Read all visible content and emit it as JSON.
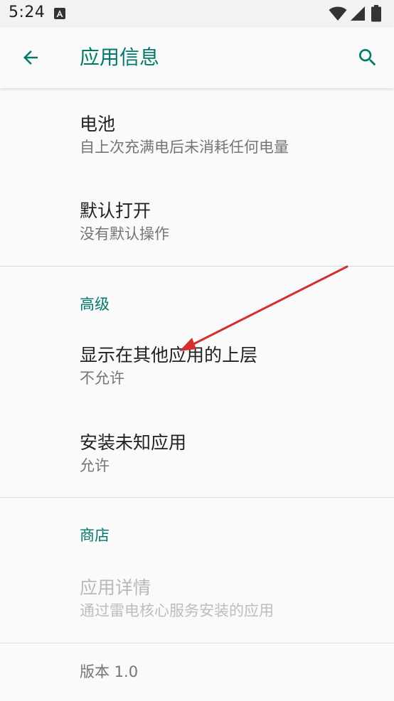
{
  "status_bar": {
    "time": "5:24",
    "notification_icon": "a-icon",
    "wifi_icon": "wifi-icon",
    "signal_icon": "signal-icon",
    "battery_icon": "battery-icon"
  },
  "app_bar": {
    "title": "应用信息",
    "back_icon": "arrow-back-icon",
    "search_icon": "search-icon",
    "accent_color": "#00796b"
  },
  "preferences": {
    "battery": {
      "title": "电池",
      "summary": "自上次充满电后未消耗任何电量"
    },
    "open_by_default": {
      "title": "默认打开",
      "summary": "没有默认操作"
    },
    "advanced": {
      "header": "高级",
      "draw_over": {
        "title": "显示在其他应用的上层",
        "summary": "不允许"
      },
      "install_unknown": {
        "title": "安装未知应用",
        "summary": "允许"
      }
    },
    "store": {
      "header": "商店",
      "app_details": {
        "title": "应用详情",
        "summary": "通过雷电核心服务安装的应用"
      }
    },
    "version": "版本 1.0"
  },
  "annotation": {
    "type": "red-arrow",
    "color": "#d32f2f"
  }
}
